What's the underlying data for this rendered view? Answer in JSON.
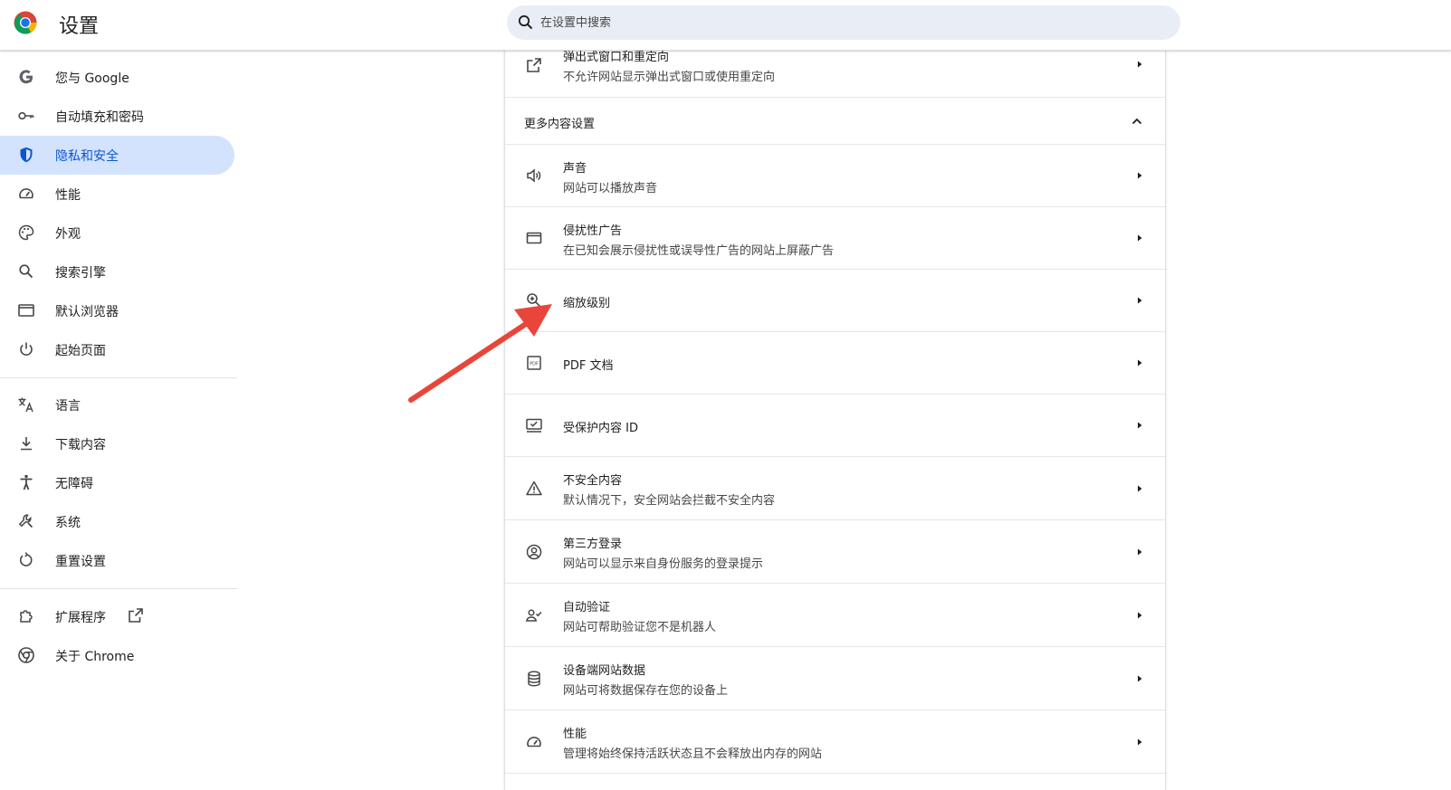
{
  "header": {
    "title": "设置",
    "search_placeholder": "在设置中搜索"
  },
  "sidebar": {
    "items": [
      {
        "label": "您与 Google",
        "icon": "google-g-icon"
      },
      {
        "label": "自动填充和密码",
        "icon": "key-icon"
      },
      {
        "label": "隐私和安全",
        "icon": "shield-icon",
        "active": true
      },
      {
        "label": "性能",
        "icon": "speedometer-icon"
      },
      {
        "label": "外观",
        "icon": "palette-icon"
      },
      {
        "label": "搜索引擎",
        "icon": "search-icon"
      },
      {
        "label": "默认浏览器",
        "icon": "browser-window-icon"
      },
      {
        "label": "起始页面",
        "icon": "power-icon"
      },
      {
        "label": "语言",
        "icon": "translate-icon"
      },
      {
        "label": "下载内容",
        "icon": "download-icon"
      },
      {
        "label": "无障碍",
        "icon": "accessibility-icon"
      },
      {
        "label": "系统",
        "icon": "wrench-icon"
      },
      {
        "label": "重置设置",
        "icon": "reset-icon"
      },
      {
        "label": "扩展程序",
        "icon": "puzzle-icon"
      },
      {
        "label": "关于 Chrome",
        "icon": "chrome-icon"
      }
    ]
  },
  "main": {
    "rows_top": [
      {
        "title": "弹出式窗口和重定向",
        "subtitle": "不允许网站显示弹出式窗口或使用重定向",
        "icon": "open-in-new-icon"
      }
    ],
    "section_title": "更多内容设置",
    "rows": [
      {
        "title": "声音",
        "subtitle": "网站可以播放声音",
        "icon": "volume-icon"
      },
      {
        "title": "侵扰性广告",
        "subtitle": "在已知会展示侵扰性或误导性广告的网站上屏蔽广告",
        "icon": "ads-window-icon"
      },
      {
        "title": "缩放级别",
        "subtitle": "",
        "icon": "zoom-in-icon"
      },
      {
        "title": "PDF 文档",
        "subtitle": "",
        "icon": "pdf-icon"
      },
      {
        "title": "受保护内容 ID",
        "subtitle": "",
        "icon": "protected-content-icon"
      },
      {
        "title": "不安全内容",
        "subtitle": "默认情况下，安全网站会拦截不安全内容",
        "icon": "warning-icon"
      },
      {
        "title": "第三方登录",
        "subtitle": "网站可以显示来自身份服务的登录提示",
        "icon": "account-circle-icon"
      },
      {
        "title": "自动验证",
        "subtitle": "网站可帮助验证您不是机器人",
        "icon": "person-check-icon"
      },
      {
        "title": "设备端网站数据",
        "subtitle": "网站可将数据保存在您的设备上",
        "icon": "database-icon"
      },
      {
        "title": "性能",
        "subtitle": "管理将始终保持活跃状态且不会释放出内存的网站",
        "icon": "speedometer-icon"
      }
    ]
  },
  "colors": {
    "accent": "#0b57d0",
    "active_bg": "#d3e3fd",
    "search_bg": "#e9eef6",
    "annotation_arrow": "#e8463a"
  }
}
